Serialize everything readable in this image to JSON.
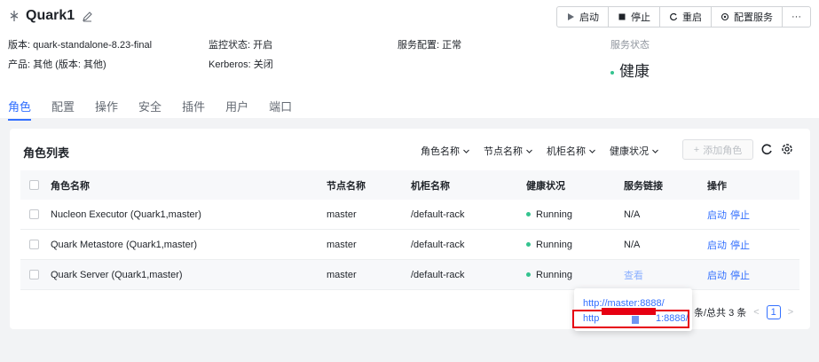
{
  "service": {
    "name": "Quark1",
    "version_label": "版本: ",
    "version_value": "quark-standalone-8.23-final",
    "product_label": "产品: ",
    "product_value": "其他 (版本: 其他)",
    "monitor_label": "监控状态: ",
    "monitor_value": "开启",
    "kerberos_label": "Kerberos: ",
    "kerberos_value": "关闭",
    "config_label": "服务配置: ",
    "config_value": "正常",
    "status_title": "服务状态",
    "health_text": "健康"
  },
  "toolbar": {
    "start": "启动",
    "stop": "停止",
    "restart": "重启",
    "configure": "配置服务",
    "more": "···"
  },
  "tabs": [
    "角色",
    "配置",
    "操作",
    "安全",
    "插件",
    "用户",
    "端口"
  ],
  "roles": {
    "title": "角色列表",
    "filters": [
      "角色名称",
      "节点名称",
      "机柜名称",
      "健康状况"
    ],
    "add_button": "添加角色",
    "columns": [
      "角色名称",
      "节点名称",
      "机柜名称",
      "健康状况",
      "服务链接",
      "操作"
    ],
    "rows": [
      {
        "name": "Nucleon Executor (Quark1,master)",
        "node": "master",
        "rack": "/default-rack",
        "health": "Running",
        "link": "N/A",
        "start": "启动",
        "stop": "停止"
      },
      {
        "name": "Quark Metastore (Quark1,master)",
        "node": "master",
        "rack": "/default-rack",
        "health": "Running",
        "link": "N/A",
        "start": "启动",
        "stop": "停止"
      },
      {
        "name": "Quark Server (Quark1,master)",
        "node": "master",
        "rack": "/default-rack",
        "health": "Running",
        "link": "查看",
        "start": "启动",
        "stop": "停止"
      }
    ],
    "pager": {
      "summary": "条/总共 3 条",
      "page": "1",
      "prev": "<",
      "next": ">"
    }
  },
  "popup": {
    "link1": "http://master:8888/",
    "link2_prefix": "http",
    "link2_suffix": "1:8888/"
  },
  "colors": {
    "accent": "#3370ff",
    "healthy": "#34c38f",
    "redaction": "#e60012"
  }
}
